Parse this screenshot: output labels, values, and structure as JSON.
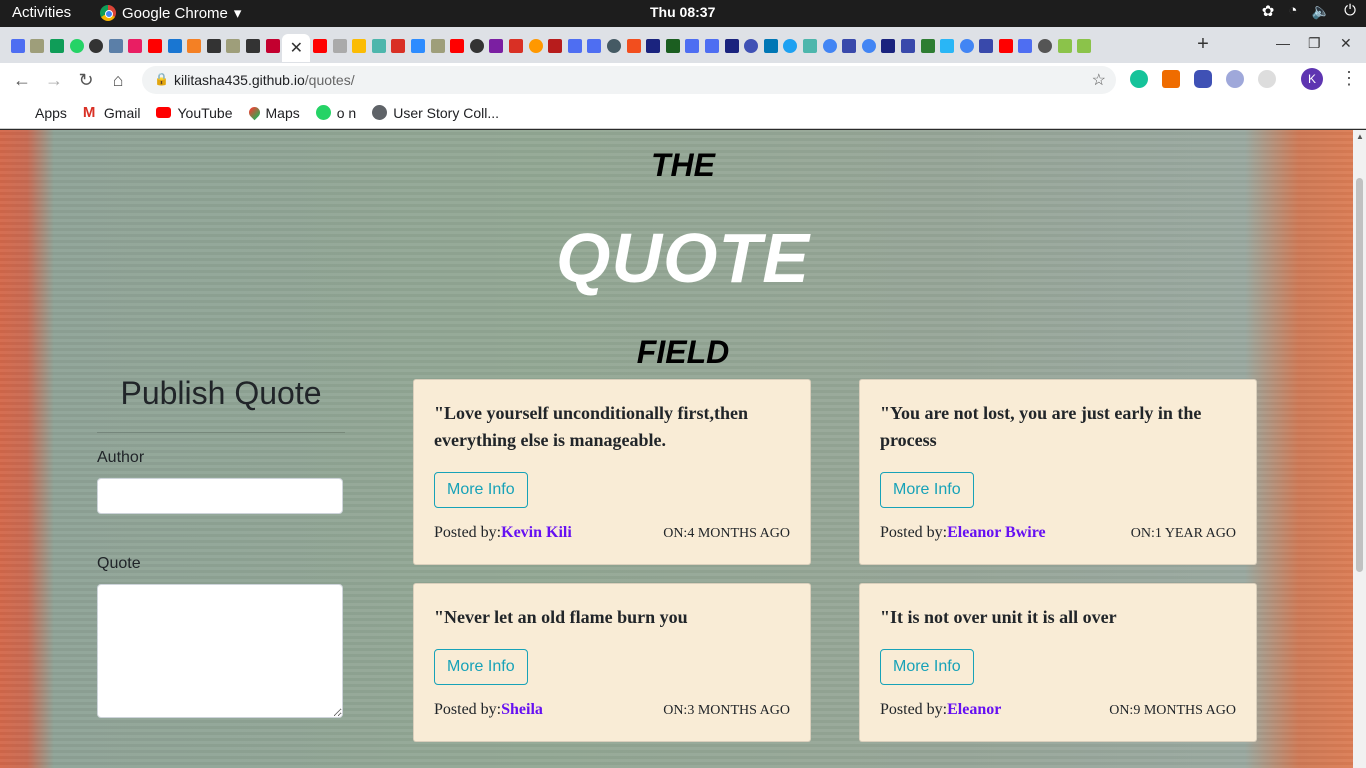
{
  "system_bar": {
    "activities": "Activities",
    "app_name": "Google Chrome",
    "clock": "Thu 08:37"
  },
  "browser": {
    "url_host": "kilitasha435.github.io",
    "url_path": "/quotes/",
    "profile_initial": "K",
    "bookmarks": [
      {
        "label": "Apps",
        "icon": "apps-grid-icon"
      },
      {
        "label": "Gmail",
        "icon": "gmail-icon"
      },
      {
        "label": "YouTube",
        "icon": "youtube-icon"
      },
      {
        "label": "Maps",
        "icon": "maps-icon"
      },
      {
        "label": "o n",
        "icon": "whatsapp-icon"
      },
      {
        "label": "User Story Coll...",
        "icon": "globe-icon"
      }
    ]
  },
  "page": {
    "title_top": "THE",
    "title_main": "QUOTE",
    "title_bottom": "FIELD",
    "form": {
      "heading": "Publish Quote",
      "author_label": "Author",
      "author_value": "",
      "quote_label": "Quote",
      "quote_value": ""
    },
    "quotes": [
      {
        "text": "\"Love yourself unconditionally first,then everything else is manageable.",
        "button": "More Info",
        "posted_label": "Posted by:",
        "author": "Kevin Kili",
        "time": "on:4 months ago"
      },
      {
        "text": "\"You are not lost, you are just early in the process",
        "button": "More Info",
        "posted_label": "Posted by:",
        "author": "Eleanor Bwire",
        "time": "on:1 year ago"
      },
      {
        "text": "\"Never let an old flame burn you",
        "button": "More Info",
        "posted_label": "Posted by:",
        "author": "Sheila",
        "time": "on:3 months ago"
      },
      {
        "text": "\"It is not over unit it is all over",
        "button": "More Info",
        "posted_label": "Posted by:",
        "author": "Eleanor",
        "time": "on:9 months ago"
      }
    ]
  },
  "colors": {
    "card_bg": "#f9ecd6",
    "button_accent": "#17a2b8",
    "author_link": "#6610f2"
  }
}
